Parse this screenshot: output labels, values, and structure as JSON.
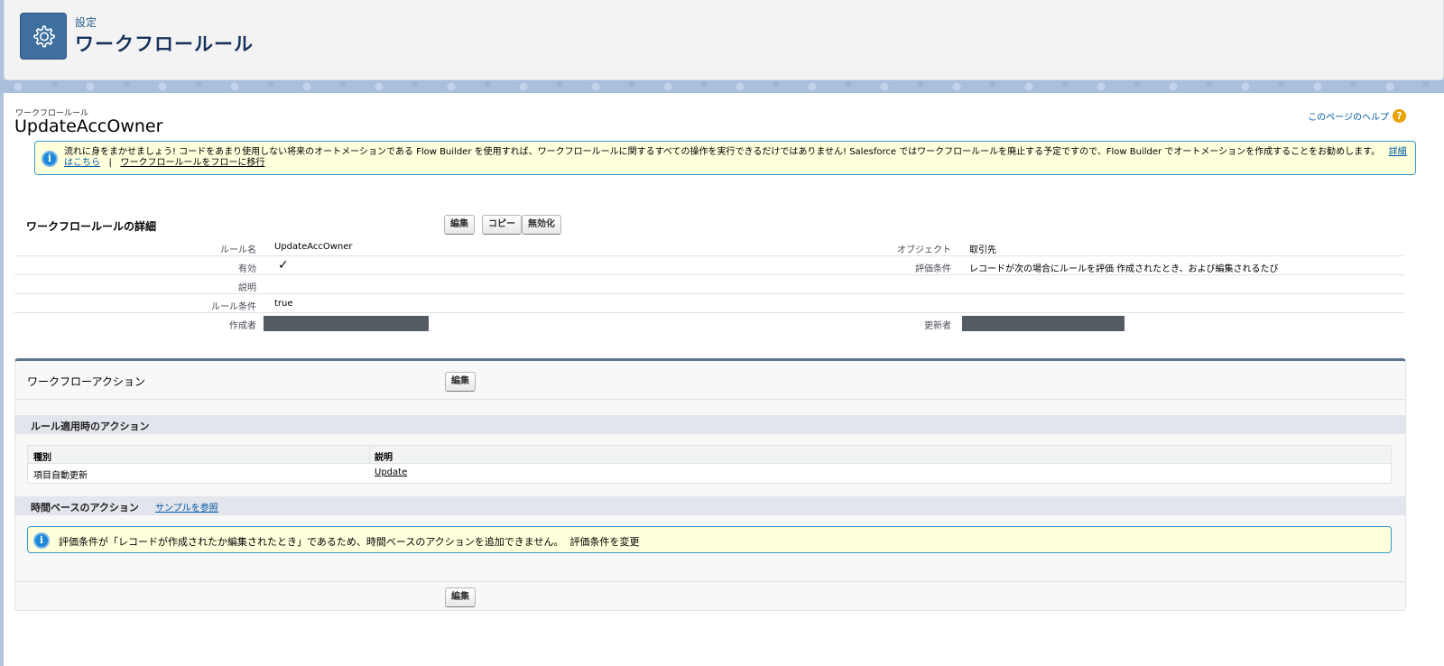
{
  "header": {
    "breadcrumb": "設定",
    "title": "ワークフロールール",
    "icon": "gear-icon",
    "tile_color": "#3e6f9e"
  },
  "record": {
    "object_type": "ワークフロールール",
    "name": "UpdateAccOwner",
    "help_link": "このページのヘルプ"
  },
  "banner": {
    "text": "流れに身をまかせましょう! コードをあまり使用しない将来のオートメーションである Flow Builder を使用すれば、ワークフロールールに関するすべての操作を実行できるだけではありません! Salesforce ではワークフロールールを廃止する予定ですので、Flow Builder でオートメーションを作成することをお勧めします。",
    "learn_more": "詳細はこちら",
    "separator": "|",
    "migrate_link": "ワークフロールールをフローに移行"
  },
  "detail": {
    "title": "ワークフロールールの詳細",
    "buttons": {
      "edit": "編集",
      "copy": "コピー",
      "deactivate": "無効化"
    },
    "fields": {
      "rule_name_label": "ルール名",
      "rule_name": "UpdateAccOwner",
      "object_label": "オブジェクト",
      "object": "取引先",
      "active_label": "有効",
      "active_check": "✓",
      "eval_label": "評価条件",
      "eval": "レコードが次の場合にルールを評価 作成されたとき、および編集されるたび",
      "desc_label": "説明",
      "criteria_label": "ルール条件",
      "criteria": "true",
      "created_by_label": "作成者",
      "modified_by_label": "更新者"
    }
  },
  "workflow_actions": {
    "title": "ワークフローアクション",
    "edit": "編集",
    "immediate_title": "ルール適用時のアクション",
    "columns": [
      "種別",
      "説明"
    ],
    "rows": [
      {
        "type": "項目自動更新",
        "description": "Update"
      }
    ],
    "time_based_title": "時間ベースのアクション",
    "samples_link": "サンプルを参照",
    "time_based_notice": "評価条件が「レコードが作成されたか編集されたとき」であるため、時間ベースのアクションを追加できません。",
    "change_eval_link": "評価条件を変更",
    "bottom_edit": "編集"
  }
}
